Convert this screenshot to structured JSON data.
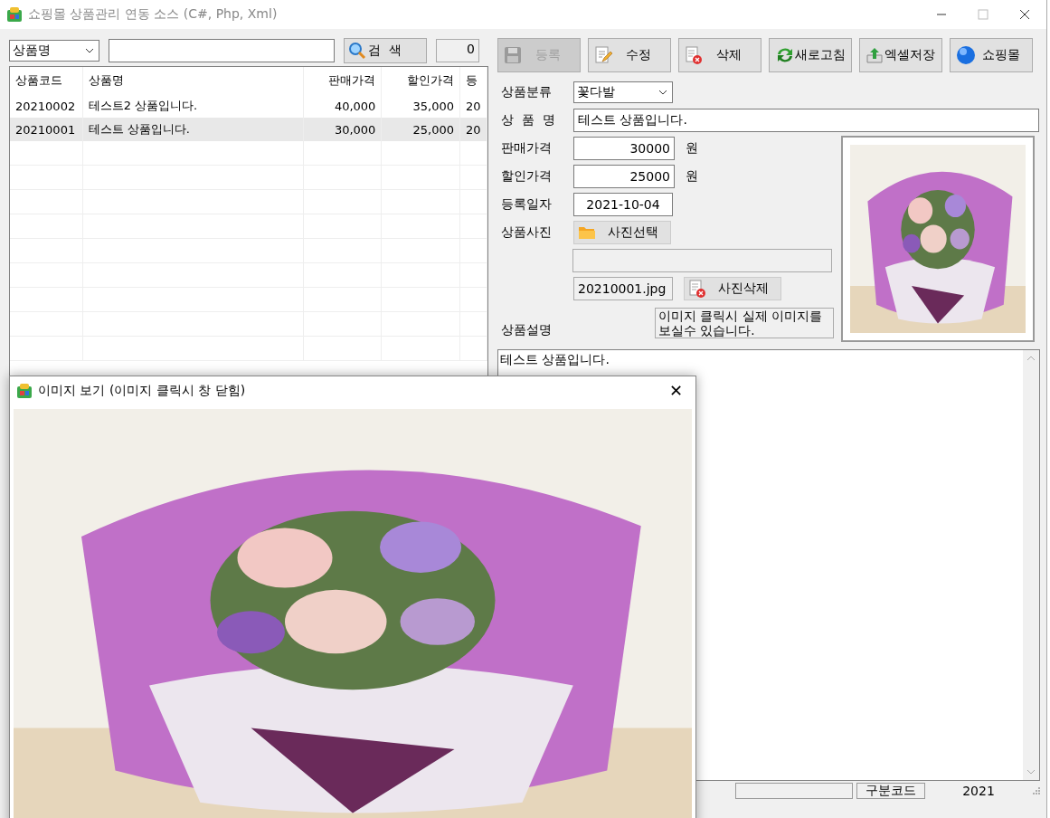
{
  "window": {
    "title": "쇼핑몰 상품관리 연동 소스 (C#, Php, Xml)"
  },
  "search": {
    "field_select": "상품명",
    "button": "검  색",
    "count": "0"
  },
  "table": {
    "columns": [
      "상품코드",
      "상품명",
      "판매가격",
      "할인가격",
      "등"
    ],
    "rows": [
      {
        "cells": [
          "20210002",
          "테스트2 상품입니다.",
          "40,000",
          "35,000",
          "20"
        ],
        "selected": false
      },
      {
        "cells": [
          "20210001",
          "테스트 상품입니다.",
          "30,000",
          "25,000",
          "20"
        ],
        "selected": true
      }
    ]
  },
  "toolbar": [
    {
      "label": "등록",
      "disabled": true
    },
    {
      "label": "수정",
      "disabled": false
    },
    {
      "label": "삭제",
      "disabled": false
    },
    {
      "label": "새로고침",
      "disabled": false
    },
    {
      "label": "엑셀저장",
      "disabled": false
    },
    {
      "label": "쇼핑몰",
      "disabled": false
    }
  ],
  "form": {
    "category_label": "상품분류",
    "category": "꽃다발",
    "name_label": "상  품  명",
    "name": "테스트 상품입니다.",
    "price_label": "판매가격",
    "price": "30000",
    "price_unit": "원",
    "discount_label": "할인가격",
    "discount": "25000",
    "discount_unit": "원",
    "date_label": "등록일자",
    "date": "2021-10-04",
    "photo_label": "상품사진",
    "photo_button": "사진선택",
    "photo_file": "20210001.jpg",
    "photo_delete": "사진삭제",
    "hint": "이미지 클릭시 실제 이미지를 보실수 있습니다.",
    "description_label": "상품설명",
    "description": "테스트 상품입니다."
  },
  "status_bar": {
    "panel_2": "구분코드",
    "panel_3": "2021"
  },
  "image_window": {
    "title": "이미지 보기 (이미지 클릭시 창 닫힘)",
    "close": "✕"
  }
}
